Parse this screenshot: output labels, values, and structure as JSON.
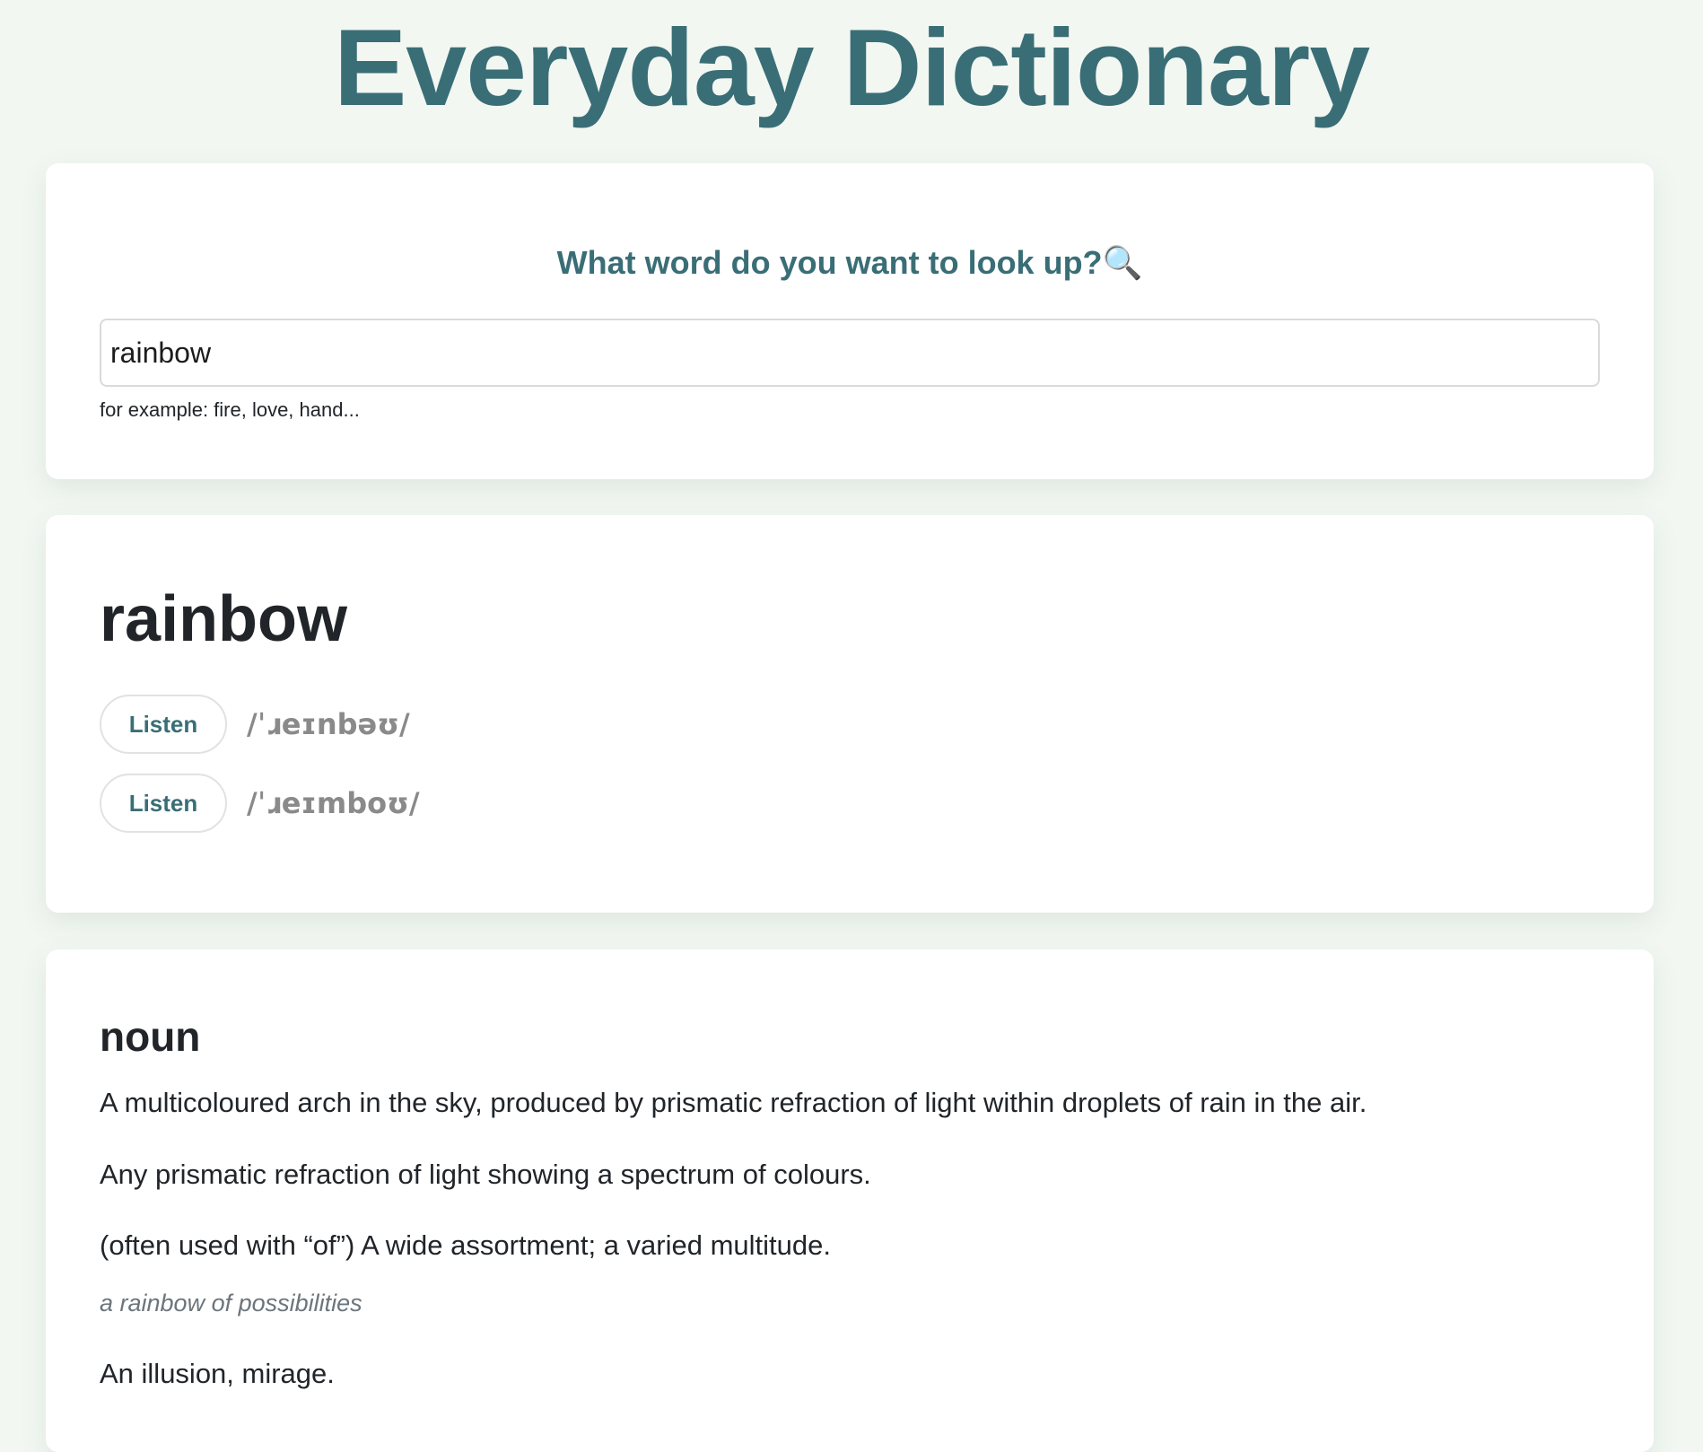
{
  "app": {
    "title": "Everyday Dictionary"
  },
  "search": {
    "heading": "What word do you want to look up?🔍",
    "value": "rainbow",
    "hint": "for example: fire, love, hand..."
  },
  "entry": {
    "word": "rainbow",
    "phonetics": [
      {
        "button_label": "Listen",
        "text": "/ˈɹeɪnbəʊ/"
      },
      {
        "button_label": "Listen",
        "text": "/ˈɹeɪmboʊ/"
      }
    ]
  },
  "meanings": [
    {
      "part_of_speech": "noun",
      "definitions": [
        {
          "text": "A multicoloured arch in the sky, produced by prismatic refraction of light within droplets of rain in the air."
        },
        {
          "text": "Any prismatic refraction of light showing a spectrum of colours."
        },
        {
          "text": "(often used with “of”) A wide assortment; a varied multitude.",
          "example": "a rainbow of possibilities"
        },
        {
          "text": "An illusion, mirage."
        }
      ]
    }
  ],
  "colors": {
    "accent": "#3a6e76",
    "background": "#f2f7f2",
    "card": "#ffffff",
    "muted": "#8a8a8a"
  }
}
